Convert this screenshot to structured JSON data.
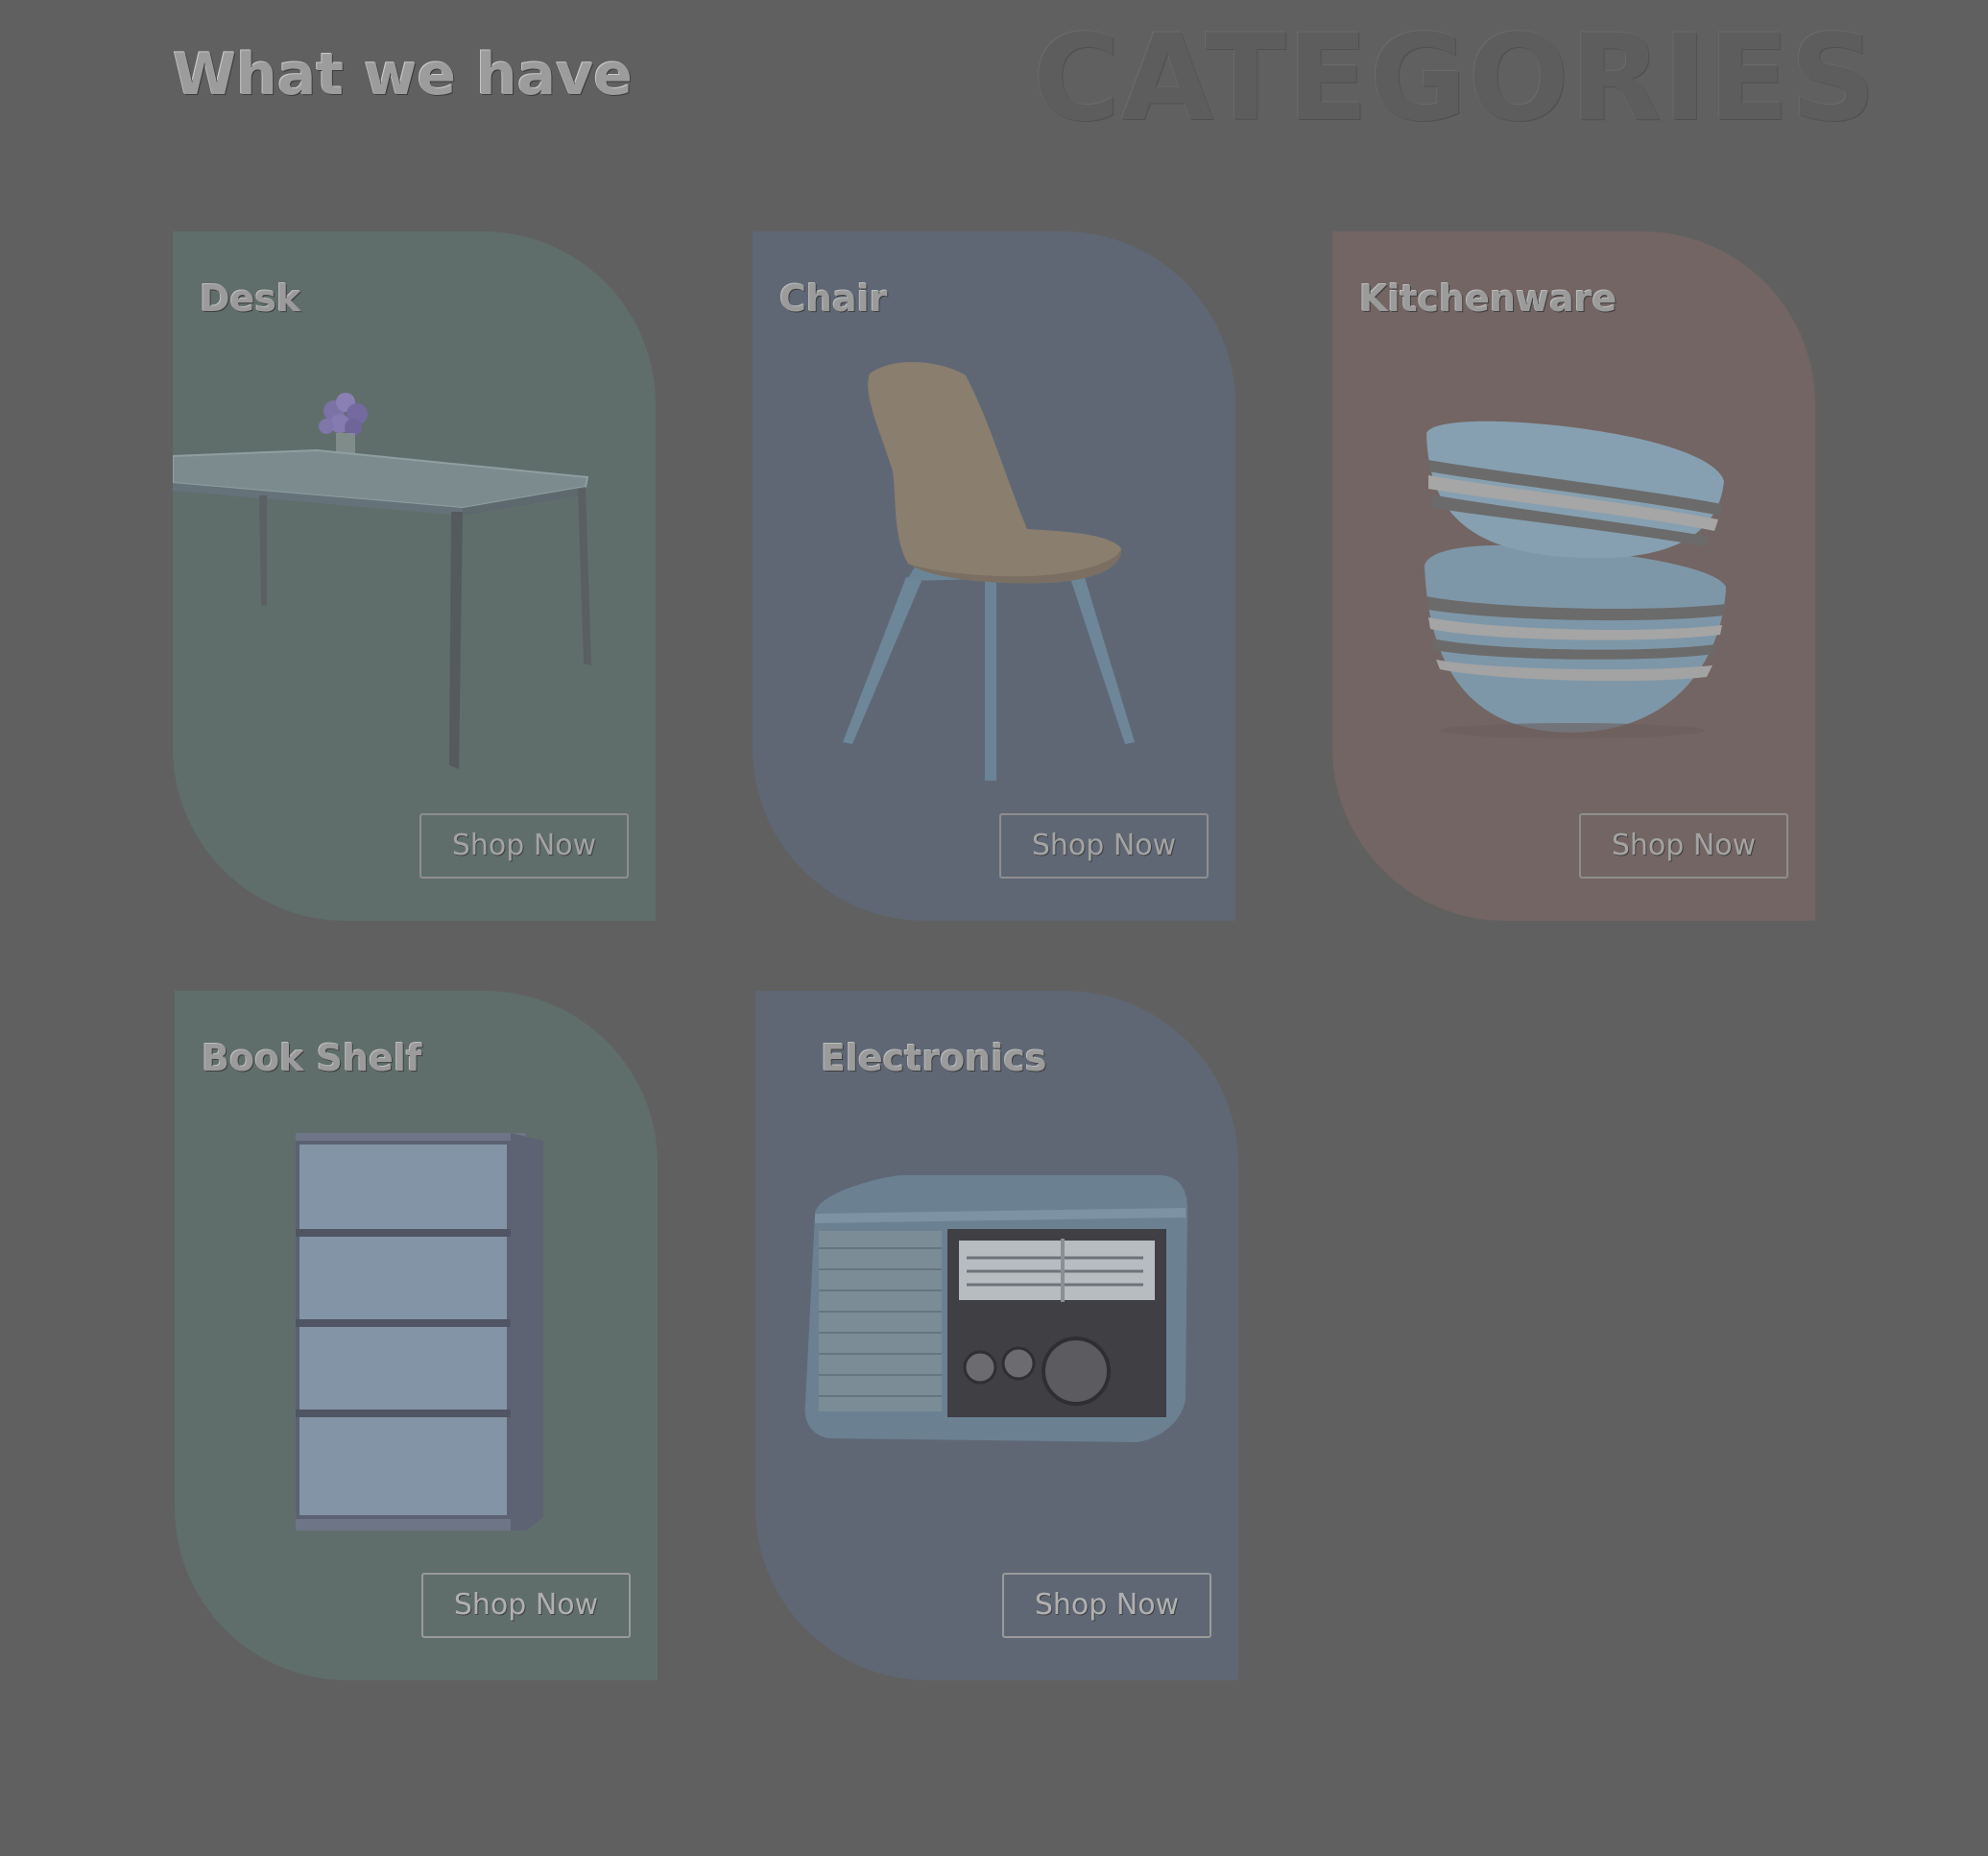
{
  "section": {
    "heading": "What we have",
    "watermark": "CATEGORIES"
  },
  "categories": [
    {
      "name": "Desk",
      "button": "Shop Now",
      "tint": "#5f6e6b",
      "icon": "desk-table-icon"
    },
    {
      "name": "Chair",
      "button": "Shop Now",
      "tint": "#5f6775",
      "icon": "chair-icon"
    },
    {
      "name": "Kitchenware",
      "button": "Shop Now",
      "tint": "#736563",
      "icon": "bowls-icon"
    },
    {
      "name": "Book Shelf",
      "button": "Shop Now",
      "tint": "#5f6e6b",
      "icon": "bookshelf-icon"
    },
    {
      "name": "Electronics",
      "button": "Shop Now",
      "tint": "#5f6775",
      "icon": "radio-icon"
    }
  ]
}
